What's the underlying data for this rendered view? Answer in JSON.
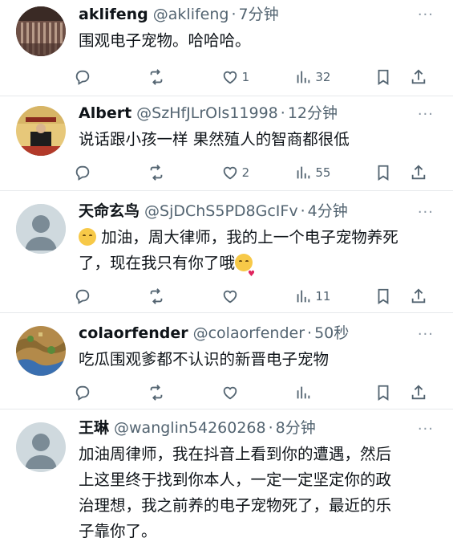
{
  "colors": {
    "text": "#0f1419",
    "secondary": "#536471",
    "divider": "#e6e9eb"
  },
  "tweets": [
    {
      "name": "aklifeng",
      "handle": "@aklifeng",
      "sep": "·",
      "time": "7分钟",
      "more": "···",
      "text": "围观电子宠物。哈哈哈。",
      "likes": "1",
      "views": "32",
      "avatar": "photo-dark-bars"
    },
    {
      "name": "Albert",
      "handle": "@SzHfJLrOls11998",
      "sep": "·",
      "time": "12分钟",
      "more": "···",
      "text": "说话跟小孩一样 果然殖人的智商都很低",
      "likes": "2",
      "views": "55",
      "avatar": "last-emperor-poster"
    },
    {
      "name": "天命玄鸟",
      "handle": "@SjDChS5PD8GcIFv",
      "sep": "·",
      "time": "4分钟",
      "more": "···",
      "text_line1": "加油，周大律师，我的上一个电子宠物养死",
      "text_line2": "了，现在我只有你了哦",
      "likes": "",
      "views": "11",
      "avatar": "default-avatar"
    },
    {
      "name": "colaorfender",
      "handle": "@colaorfender",
      "sep": "·",
      "time": "50秒",
      "more": "···",
      "text": "吃瓜围观爹都不认识的新晋电子宠物",
      "likes": "",
      "views": "",
      "avatar": "game-map"
    },
    {
      "name": "王琳",
      "handle": "@wanglin54260268",
      "sep": "·",
      "time": "8分钟",
      "more": "···",
      "text_lines": [
        "加油周律师，我在抖音上看到你的遭遇，然后",
        "上这里终于找到你本人，一定一定坚定你的政",
        "治理想，我之前养的电子宠物死了，最近的乐",
        "子靠你了。"
      ],
      "avatar": "default-avatar"
    }
  ],
  "icons": [
    "reply-icon",
    "retweet-icon",
    "like-icon",
    "views-icon",
    "bookmark-icon",
    "share-icon"
  ]
}
